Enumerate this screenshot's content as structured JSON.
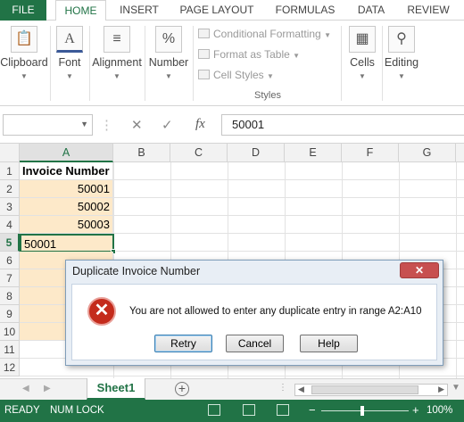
{
  "ribbon_tabs": [
    "FILE",
    "HOME",
    "INSERT",
    "PAGE LAYOUT",
    "FORMULAS",
    "DATA",
    "REVIEW"
  ],
  "ribbon_groups": {
    "clipboard": "Clipboard",
    "font": "Font",
    "alignment": "Alignment",
    "number": "Number",
    "cells": "Cells",
    "editing": "Editing"
  },
  "styles_group": {
    "items": [
      "Conditional Formatting",
      "Format as Table",
      "Cell Styles"
    ],
    "label": "Styles"
  },
  "formula_bar": {
    "cancel_symbol": "✕",
    "enter_symbol": "✓",
    "fx_symbol": "fx",
    "value": "50001"
  },
  "columns": [
    "A",
    "B",
    "C",
    "D",
    "E",
    "F",
    "G"
  ],
  "rows": [
    "1",
    "2",
    "3",
    "4",
    "5",
    "6",
    "7",
    "8",
    "9",
    "10",
    "11",
    "12"
  ],
  "cells": {
    "A1": "Invoice Number",
    "A2": "50001",
    "A3": "50002",
    "A4": "50003",
    "A5": "50001"
  },
  "sheet_tabs": [
    "Sheet1"
  ],
  "add_sheet_symbol": "+",
  "status": {
    "ready": "READY",
    "num_lock": "NUM LOCK",
    "zoom_minus": "−",
    "zoom_plus": "+",
    "zoom": "100%"
  },
  "dialog": {
    "title": "Duplicate Invoice Number",
    "close_symbol": "✕",
    "icon_symbol": "✕",
    "message": "You are not allowed to enter any duplicate entry in range A2:A10",
    "buttons": {
      "retry": "Retry",
      "cancel": "Cancel",
      "help": "Help"
    }
  },
  "colors": {
    "excel_green": "#217346",
    "shaded_cell": "#fde9c9",
    "error_red": "#c42b1c"
  },
  "icons": [
    "paste-icon",
    "font-icon",
    "alignment-icon",
    "percent-icon",
    "cells-icon",
    "find-icon",
    "error-icon"
  ]
}
